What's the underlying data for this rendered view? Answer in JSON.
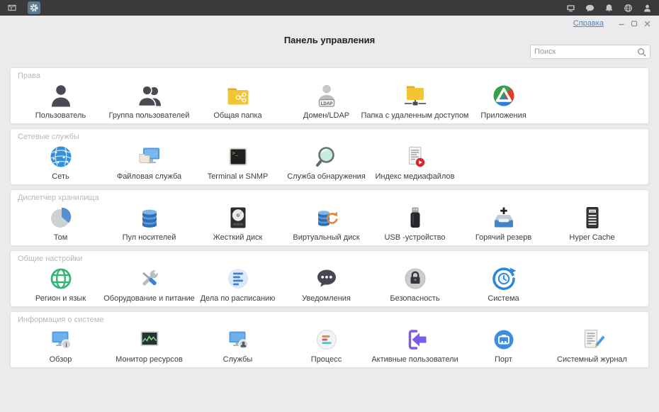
{
  "topbar": {
    "left_icons": [
      {
        "name": "app-launcher-icon",
        "active": false
      },
      {
        "name": "control-panel-app-icon",
        "active": true
      }
    ],
    "right_icons": [
      {
        "name": "screen-share-icon"
      },
      {
        "name": "chat-icon"
      },
      {
        "name": "notification-bell-icon"
      },
      {
        "name": "globe-icon"
      },
      {
        "name": "account-icon"
      }
    ]
  },
  "window": {
    "help_label": "Справка",
    "controls": [
      {
        "name": "minimize-icon"
      },
      {
        "name": "restore-icon"
      },
      {
        "name": "close-icon"
      }
    ]
  },
  "header": {
    "title": "Панель управления"
  },
  "search": {
    "placeholder": "Поиск",
    "icon": "search-icon"
  },
  "sections": [
    {
      "label": "Права",
      "items": [
        {
          "label": "Пользователь",
          "icon": "user-icon"
        },
        {
          "label": "Группа пользователей",
          "icon": "user-group-icon"
        },
        {
          "label": "Общая папка",
          "icon": "shared-folder-icon"
        },
        {
          "label": "Домен/LDAP",
          "icon": "ldap-user-icon"
        },
        {
          "label": "Папка с удаленным доступом",
          "icon": "remote-folder-icon"
        },
        {
          "label": "Приложения",
          "icon": "applications-icon"
        }
      ]
    },
    {
      "label": "Сетевые службы",
      "items": [
        {
          "label": "Сеть",
          "icon": "network-icon"
        },
        {
          "label": "Файловая служба",
          "icon": "file-service-icon"
        },
        {
          "label": "Terminal и SNMP",
          "icon": "terminal-icon"
        },
        {
          "label": "Служба обнаружения",
          "icon": "discovery-icon"
        },
        {
          "label": "Индекс медиафайлов",
          "icon": "media-index-icon"
        }
      ]
    },
    {
      "label": "Диспетчер хранилища",
      "items": [
        {
          "label": "Том",
          "icon": "volume-icon"
        },
        {
          "label": "Пул носителей",
          "icon": "storage-pool-icon"
        },
        {
          "label": "Жесткий диск",
          "icon": "hdd-icon"
        },
        {
          "label": "Виртуальный диск",
          "icon": "virtual-disk-icon"
        },
        {
          "label": "USB -устройство",
          "icon": "usb-icon"
        },
        {
          "label": "Горячий резерв",
          "icon": "hot-spare-icon"
        },
        {
          "label": "Hyper Cache",
          "icon": "hyper-cache-icon"
        }
      ]
    },
    {
      "label": "Общие настройки",
      "items": [
        {
          "label": "Регион и язык",
          "icon": "region-language-icon"
        },
        {
          "label": "Оборудование и питание",
          "icon": "hardware-power-icon"
        },
        {
          "label": "Дела по расписанию",
          "icon": "scheduled-tasks-icon"
        },
        {
          "label": "Уведомления",
          "icon": "notifications-icon"
        },
        {
          "label": "Безопасность",
          "icon": "security-icon"
        },
        {
          "label": "Система",
          "icon": "system-icon"
        }
      ]
    },
    {
      "label": "Информация о системе",
      "items": [
        {
          "label": "Обзор",
          "icon": "overview-icon"
        },
        {
          "label": "Монитор ресурсов",
          "icon": "resource-monitor-icon"
        },
        {
          "label": "Службы",
          "icon": "services-icon"
        },
        {
          "label": "Процесс",
          "icon": "process-icon"
        },
        {
          "label": "Активные пользователи",
          "icon": "active-users-icon"
        },
        {
          "label": "Порт",
          "icon": "port-icon"
        },
        {
          "label": "Системный журнал",
          "icon": "system-log-icon"
        }
      ]
    }
  ]
}
